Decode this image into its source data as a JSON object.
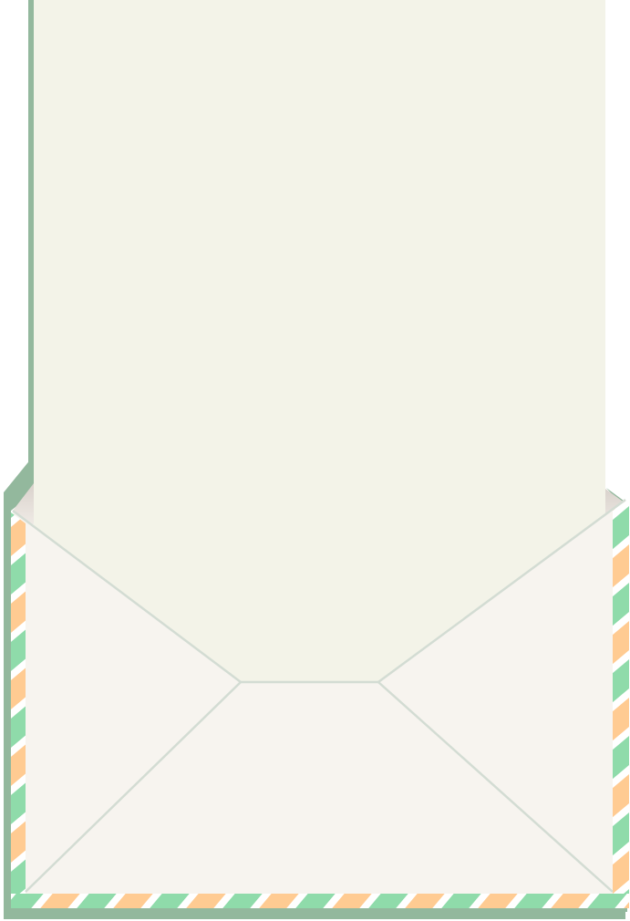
{
  "scene": {
    "name": "airmail-envelope-with-letter",
    "letter": {
      "paper_color": "#F3F3E8",
      "shadow_color": "#93B89D"
    },
    "envelope": {
      "body_color": "#F7F4EF",
      "inner_color": "#E8E2DC",
      "fold_line_color": "#D3DCD3",
      "shadow_color": "#93B89D",
      "airmail_stripe_colors": [
        "#FFCB92",
        "#FFFFFF",
        "#8FDBAA",
        "#FFFFFF"
      ]
    }
  }
}
